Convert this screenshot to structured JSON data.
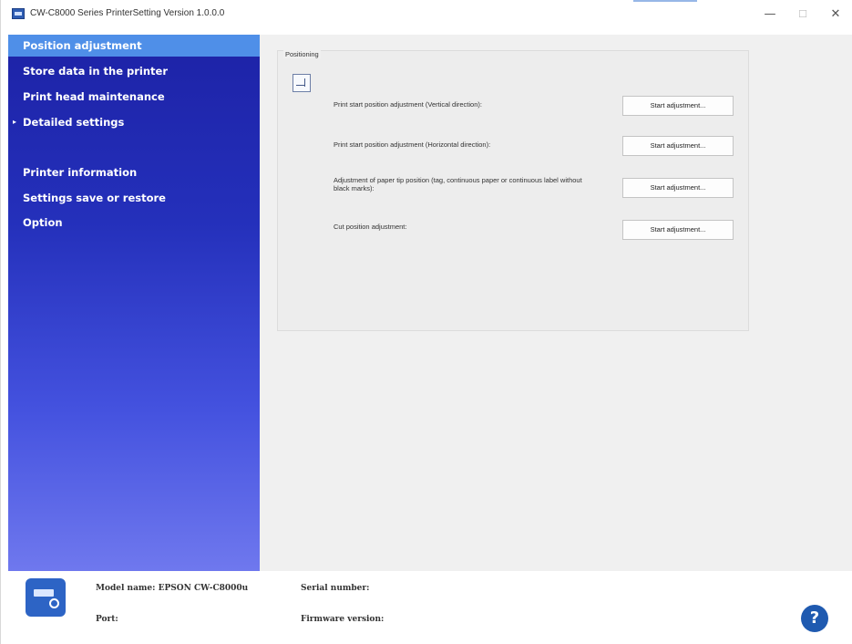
{
  "window": {
    "title": "CW-C8000 Series PrinterSetting Version 1.0.0.0",
    "controls": {
      "minimize": "—",
      "maximize": "☐",
      "close": "✕"
    }
  },
  "sidebar": {
    "items": [
      {
        "label": "Position adjustment",
        "active": true
      },
      {
        "label": "Store data in the printer"
      },
      {
        "label": "Print head maintenance"
      },
      {
        "label": "Detailed settings",
        "arrow": "▸"
      },
      {
        "label": "Printer information"
      },
      {
        "label": "Settings save or restore"
      },
      {
        "label": "Option"
      }
    ]
  },
  "main": {
    "group_label": "Positioning",
    "rows": [
      {
        "label": "Print start position adjustment (Vertical direction):",
        "button": "Start adjustment..."
      },
      {
        "label": "Print start position adjustment (Horizontal direction):",
        "button": "Start adjustment..."
      },
      {
        "label": "Adjustment of paper tip position (tag, continuous paper or continuous label without black marks):",
        "button": "Start adjustment..."
      },
      {
        "label": "Cut position adjustment:",
        "button": "Start adjustment..."
      }
    ]
  },
  "footer": {
    "model_label": "Model name: EPSON CW-C8000u",
    "port_label": "Port:",
    "serial_label": "Serial number:",
    "firmware_label": "Firmware version:",
    "help_glyph": "?"
  },
  "colors": {
    "sidebar_top": "#1d22a6",
    "sidebar_bottom": "#6f78ee",
    "active_item": "#4f8fe8",
    "help_button": "#1f5ab0"
  }
}
